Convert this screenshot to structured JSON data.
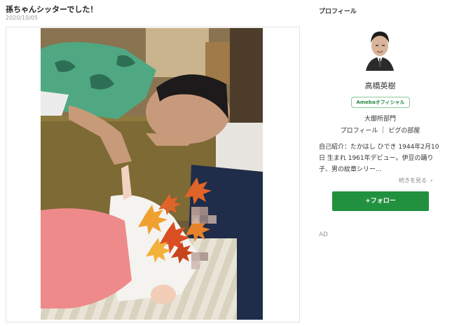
{
  "post": {
    "title": "孫ちゃんシッターでした！",
    "date": "2020/10/05"
  },
  "sidebar": {
    "heading": "プロフィール",
    "name": "高橋英樹",
    "badge": "Amebaオフィシャル",
    "department": "大御所部門",
    "link_profile": "プロフィール",
    "link_room": "ピグの部屋",
    "bio": "自己紹介：たかはし ひでき 1944年2月10日 生まれ 1961年デビュー。伊豆の踊り子、男の紋章シリー...",
    "more_label": "続きを見る",
    "follow_label": "+フォロー",
    "ad_label": "AD"
  },
  "colors": {
    "follow_green": "#21913f",
    "badge_green": "#2a8a3f"
  }
}
